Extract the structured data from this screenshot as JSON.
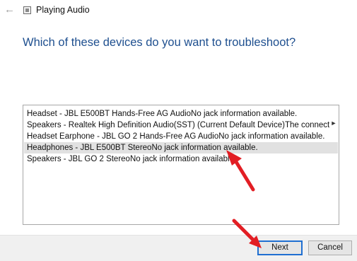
{
  "window": {
    "title": "Playing Audio",
    "back_icon": "back-arrow-icon",
    "app_icon": "window-icon"
  },
  "heading": "Which of these devices do you want to troubleshoot?",
  "devices": [
    {
      "label": "Headset - JBL E500BT Hands-Free AG AudioNo jack information available.",
      "selected": false
    },
    {
      "label": "Speakers - Realtek High Definition Audio(SST) (Current Default Device)The connector for the Speakers is not available.",
      "selected": false
    },
    {
      "label": "Headset Earphone - JBL GO 2 Hands-Free AG AudioNo jack information available.",
      "selected": false
    },
    {
      "label": "Headphones - JBL E500BT StereoNo jack information available.",
      "selected": true
    },
    {
      "label": "Speakers - JBL GO 2 StereoNo jack information available.",
      "selected": false
    }
  ],
  "buttons": {
    "next": "Next",
    "cancel": "Cancel"
  },
  "colors": {
    "heading": "#1e4f8f",
    "selection": "#e1e1e1",
    "annotation_arrow": "#e21e24",
    "default_button_border": "#1f6fd1"
  }
}
